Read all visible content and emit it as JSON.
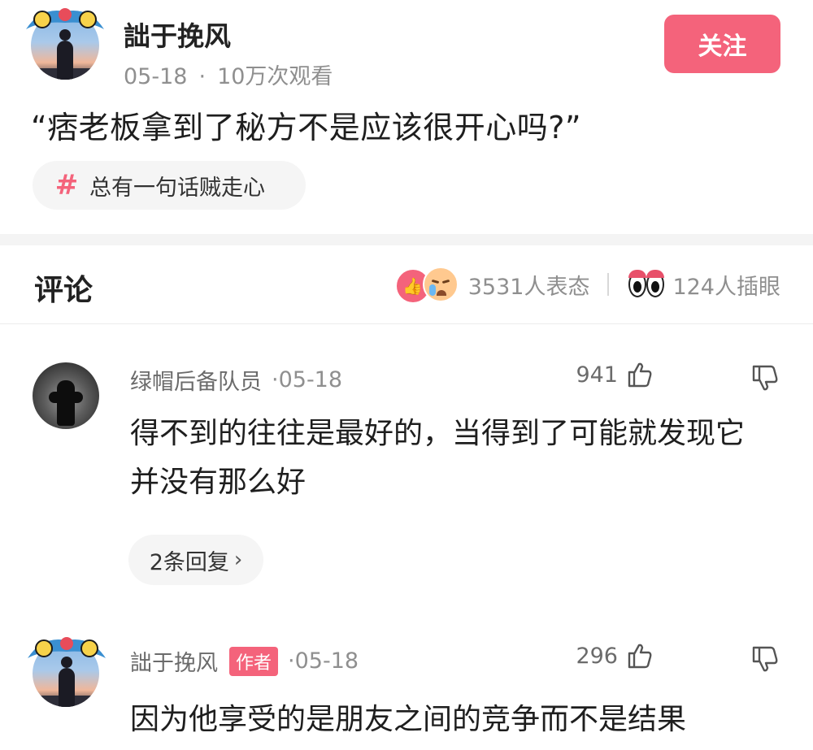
{
  "post": {
    "author": "詘于挽风",
    "date": "05-18",
    "separator": "·",
    "views": "10万次观看",
    "follow_label": "关注",
    "text": "“痞老板拿到了秘方不是应该很开心吗?”",
    "topic_hash": "#",
    "topic": "总有一句话贼走心"
  },
  "comments_section": {
    "title": "评论",
    "reactions_count": "3531人表态",
    "views_count": "124人插眼",
    "like_icon_glyph": "👍",
    "accent_color": "#f4637b"
  },
  "comments": [
    {
      "user": "绿帽后备队员",
      "time": "·05-18",
      "likes": "941",
      "text": "得不到的往往是最好的，当得到了可能就发现它并没有那么好",
      "replies": "2条回复",
      "reply_chevron": "›"
    },
    {
      "user": "詘于挽风",
      "badge": "作者",
      "time": "·05-18",
      "likes": "296",
      "text": "因为他享受的是朋友之间的竞争而不是结果"
    }
  ]
}
